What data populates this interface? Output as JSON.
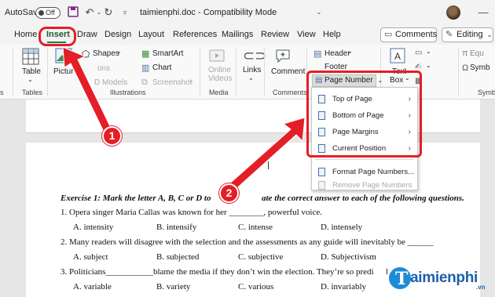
{
  "titlebar": {
    "autosave_label": "AutoSave",
    "autosave_state": "Off",
    "doc_title": "taimienphi.doc - Compatibility Mode"
  },
  "tabs": [
    {
      "label": "Home"
    },
    {
      "label": "Insert",
      "active": true
    },
    {
      "label": "Draw"
    },
    {
      "label": "Design"
    },
    {
      "label": "Layout"
    },
    {
      "label": "References"
    },
    {
      "label": "Mailings"
    },
    {
      "label": "Review"
    },
    {
      "label": "View"
    },
    {
      "label": "Help"
    }
  ],
  "header_buttons": {
    "comments": "Comments",
    "editing": "Editing"
  },
  "ribbon": {
    "table": "Table",
    "tables_group": "Tables",
    "pictures": "Pictur",
    "shapes": "Shapes",
    "icons": "ons",
    "models_3d": "D Models",
    "smartart": "SmartArt",
    "chart": "Chart",
    "screenshot": "Screenshot",
    "illustrations_group": "Illustrations",
    "online_videos_1": "Online",
    "online_videos_2": "Videos",
    "media_group": "Media",
    "links": "Links",
    "comment": "Comment",
    "comments_group": "Comments",
    "header": "Header",
    "footer": "Footer",
    "text_box_1": "Text",
    "text_box_2": "Box",
    "equation": "Equ",
    "symbol": "Symb",
    "symbols_group": "Symb",
    "left_group": "s"
  },
  "page_number_button": "Page Number",
  "menu": {
    "items": [
      {
        "label": "Top of Page",
        "has_submenu": true,
        "disabled": false
      },
      {
        "label": "Bottom of Page",
        "has_submenu": true,
        "disabled": false
      },
      {
        "label": "Page Margins",
        "has_submenu": true,
        "disabled": false
      },
      {
        "label": "Current Position",
        "has_submenu": true,
        "disabled": false
      },
      {
        "label": "Format Page Numbers...",
        "has_submenu": false,
        "disabled": false
      },
      {
        "label": "Remove Page Numbers",
        "has_submenu": false,
        "disabled": true
      }
    ]
  },
  "document": {
    "exercise_a": "Exercise 1: Mark the letter A, B, C or D to",
    "exercise_b": "ate the correct answer to each of the following questions.",
    "q1": "1.   Opera singer Maria Callas was known for her ________, powerful voice.",
    "q1_opts": [
      "A. intensity",
      "B. intensify",
      "C. intense",
      "D. intensely"
    ],
    "q2": "2. Many readers will disagree with the selection and the assessments as any guide will inevitably be ______",
    "q2_opts": [
      "A. subject",
      "B. subjected",
      "C. subjective",
      "D. Subjectivism"
    ],
    "q3": "3. Politicians___________blame the media if they don’t win the election. They’re so predi",
    "q3_tail": "le.",
    "q3_opts": [
      "A. variable",
      "B. variety",
      "C. various",
      "D. invariably"
    ]
  },
  "annotations": {
    "badge1": "1",
    "badge2": "2",
    "color": "#e41e26"
  },
  "logo": {
    "letter": "T",
    "text": "aimienphi",
    "suffix": ".vn"
  }
}
